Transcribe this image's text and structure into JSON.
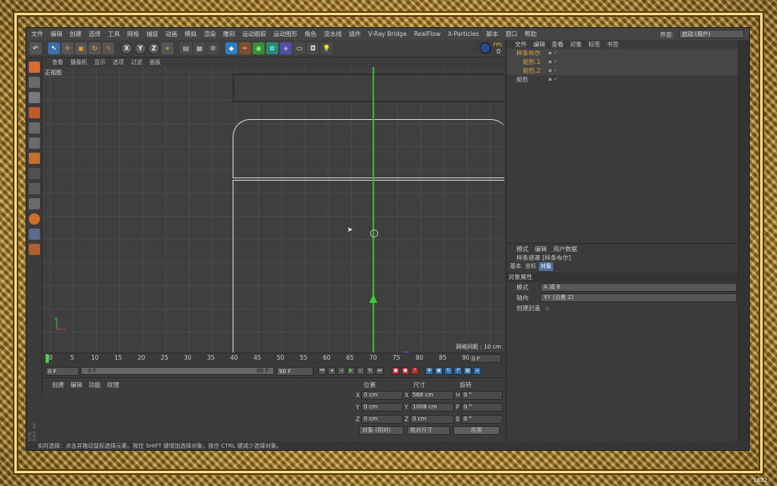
{
  "menubar": {
    "items": [
      "文件",
      "编辑",
      "创建",
      "选择",
      "工具",
      "网格",
      "捕捉",
      "动画",
      "模拟",
      "渲染",
      "雕刻",
      "运动跟踪",
      "运动图形",
      "角色",
      "流水线",
      "插件",
      "V-Ray Bridge",
      "RealFlow",
      "X-Particles",
      "脚本",
      "窗口",
      "帮助"
    ],
    "layout_label": "界面:",
    "layout_value": "启动 (用户)"
  },
  "toolbar": {
    "axis_x": "X",
    "axis_y": "Y",
    "axis_z": "Z",
    "right_value": "0"
  },
  "viewport": {
    "menu": [
      "查看",
      "摄像机",
      "显示",
      "选项",
      "过滤",
      "面板"
    ],
    "name": "正视图",
    "grid_spacing": "网格间距 : 10 cm"
  },
  "timeline": {
    "ticks": [
      "0",
      "5",
      "10",
      "15",
      "20",
      "25",
      "30",
      "35",
      "40",
      "45",
      "50",
      "55",
      "60",
      "65",
      "70",
      "75",
      "80",
      "85",
      "90"
    ],
    "current_frame": "0 F",
    "start_frame": "0 F",
    "slider_left": "0 F",
    "slider_right": "90 F",
    "end_frame": "90 F"
  },
  "material": {
    "menu": [
      "创建",
      "编辑",
      "功能",
      "纹理"
    ],
    "logo": "MAXON CINEMA 4D"
  },
  "coords": {
    "headers": [
      "位置",
      "尺寸",
      "旋转"
    ],
    "rows": [
      {
        "pos_label": "X",
        "pos": "0 cm",
        "size_label": "X",
        "size": "568 cm",
        "rot_label": "H",
        "rot": "0 °"
      },
      {
        "pos_label": "Y",
        "pos": "0 cm",
        "size_label": "Y",
        "size": "1008 cm",
        "rot_label": "P",
        "rot": "0 °"
      },
      {
        "pos_label": "Z",
        "pos": "0 cm",
        "size_label": "Z",
        "size": "0 cm",
        "rot_label": "B",
        "rot": "0 °"
      }
    ],
    "mode_select": "对象 (相对)",
    "size_select": "绝对尺寸",
    "apply": "应用"
  },
  "object_manager": {
    "menu": [
      "文件",
      "编辑",
      "查看",
      "对象",
      "标签",
      "书签"
    ],
    "items": [
      {
        "name": "样条布尔",
        "selected": true
      },
      {
        "name": "矩形.1",
        "selected": true
      },
      {
        "name": "矩形.2",
        "selected": true
      },
      {
        "name": "矩形",
        "selected": false
      }
    ]
  },
  "attributes": {
    "menu": [
      "模式",
      "编辑",
      "用户数据"
    ],
    "title": "样条遮罩 [样条布尔]",
    "tabs": [
      "基本",
      "坐标",
      "对象"
    ],
    "active_tab": "对象",
    "section": "对象属性",
    "rows": [
      {
        "label": "模式",
        "value": "A 减 B"
      },
      {
        "label": "轴向",
        "value": "XY (沿着 Z)"
      },
      {
        "label": "创建封盖",
        "value": ""
      }
    ]
  },
  "statusbar": {
    "text": "实时选择：点击并拖动鼠标选择元素。按住 SHIFT 键增加选择对象；按住 CTRL 键减少选择对象。"
  },
  "watermark": "1632"
}
